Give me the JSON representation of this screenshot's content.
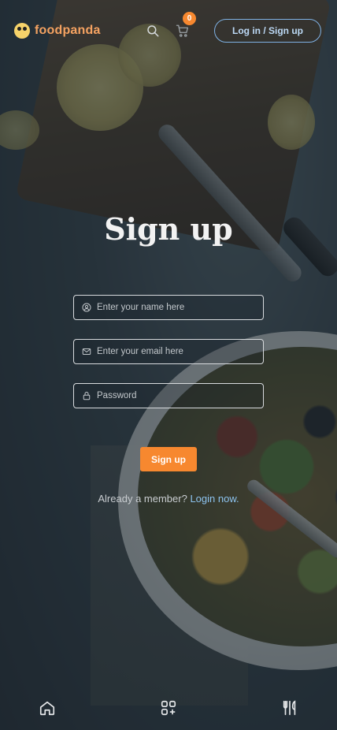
{
  "header": {
    "logo_text": "foodpanda",
    "cart_count": "0",
    "login_label": "Log in / Sign up"
  },
  "main": {
    "title": "Sign up",
    "fields": {
      "name_placeholder": "Enter your name here",
      "email_placeholder": "Enter your email here",
      "password_placeholder": "Password"
    },
    "submit_label": "Sign up",
    "member_text": "Already a member?",
    "login_link": "Login now."
  },
  "icons": {
    "search": "search-icon",
    "cart": "cart-icon",
    "user": "user-icon",
    "email": "mail-icon",
    "lock": "lock-icon",
    "home": "home-icon",
    "categories": "grid-plus-icon",
    "restaurants": "utensils-icon"
  },
  "colors": {
    "accent": "#f7882f",
    "link": "#8dc3ef",
    "brand": "#f4a261"
  }
}
